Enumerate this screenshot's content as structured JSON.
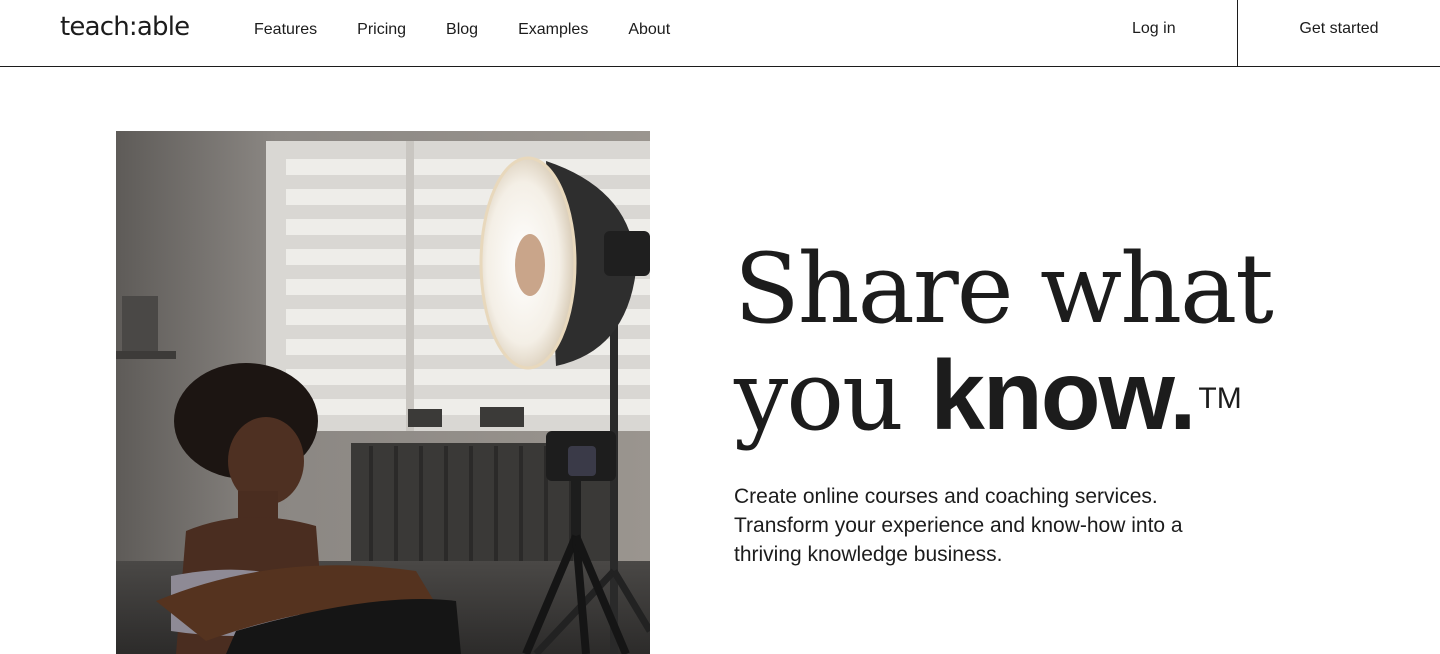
{
  "header": {
    "logo": "teach:able",
    "nav": [
      "Features",
      "Pricing",
      "Blog",
      "Examples",
      "About"
    ],
    "login_label": "Log in",
    "cta_label": "Get started"
  },
  "hero": {
    "headline_line1": "Share what",
    "headline_line2_light": "you ",
    "headline_line2_bold": "know.",
    "trademark": "TM",
    "subtext": "Create online courses and coaching services. Transform your experience and know-how into a thriving knowledge business."
  }
}
